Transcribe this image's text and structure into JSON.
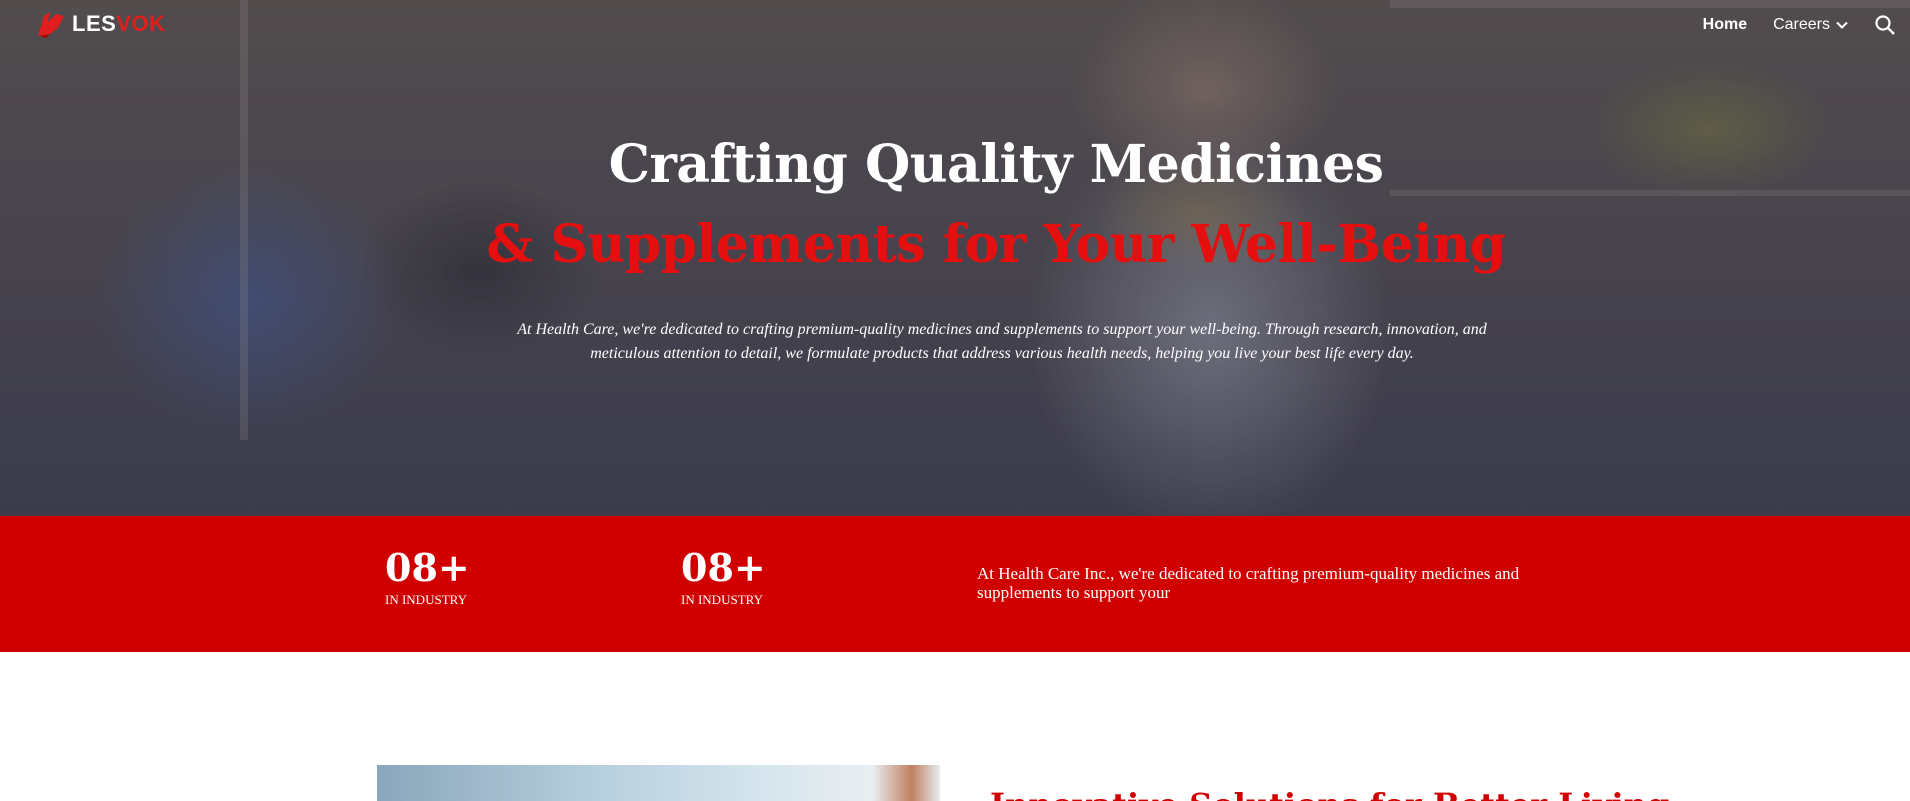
{
  "nav": {
    "logo": {
      "part1": "LES",
      "part2": "VOK"
    },
    "links": [
      {
        "label": "Home",
        "active": true
      },
      {
        "label": "Careers",
        "active": false
      }
    ],
    "search_icon": "search-icon"
  },
  "hero": {
    "title_line1": "Crafting Quality Medicines",
    "title_line2": "& Supplements for Your Well-Being",
    "description": "At Health Care, we're dedicated to crafting premium-quality medicines and supplements to support your well-being. Through research, innovation, and meticulous attention to detail, we formulate products that address various health needs, helping you live your best life every day."
  },
  "stats": {
    "items": [
      {
        "number": "08+",
        "label": "IN INDUSTRY"
      },
      {
        "number": "08+",
        "label": "IN INDUSTRY"
      }
    ],
    "text": "At Health Care Inc., we're dedicated to crafting premium-quality medicines and supplements to support your"
  },
  "section": {
    "heading": "Innovative Solutions for Better Living"
  },
  "colors": {
    "accent": "#d10000",
    "title_red": "#e60f0f",
    "white": "#ffffff"
  }
}
